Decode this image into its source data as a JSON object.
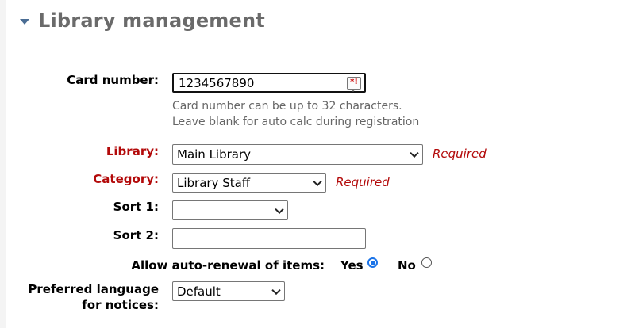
{
  "section": {
    "title": "Library management"
  },
  "card_number": {
    "label": "Card number:",
    "value": "1234567890",
    "hint_line1": "Card number can be up to 32 characters.",
    "hint_line2": "Leave blank for auto calc during registration"
  },
  "library": {
    "label": "Library:",
    "selected": "Main Library",
    "required_text": "Required"
  },
  "category": {
    "label": "Category:",
    "selected": "Library Staff",
    "required_text": "Required"
  },
  "sort1": {
    "label": "Sort 1:",
    "selected": ""
  },
  "sort2": {
    "label": "Sort 2:",
    "value": ""
  },
  "auto_renewal": {
    "label": "Allow auto-renewal of items:",
    "options": [
      {
        "label": "Yes",
        "checked": true
      },
      {
        "label": "No",
        "checked": false
      }
    ]
  },
  "preferred_language": {
    "label_line1": "Preferred language",
    "label_line2": "for notices:",
    "selected": "Default"
  },
  "colors": {
    "required": "#b30a0a",
    "header": "#6a6a6a",
    "caret": "#4a6d94",
    "radio_selected": "#1a73e8"
  }
}
